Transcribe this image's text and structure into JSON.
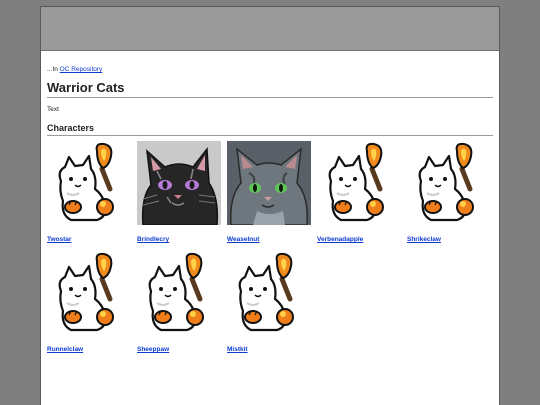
{
  "breadcrumb": {
    "prefix": "...In",
    "link": "OC Repository"
  },
  "page": {
    "title": "Warrior Cats",
    "intro": "Text"
  },
  "section": {
    "title": "Characters"
  },
  "characters": [
    {
      "name": "Twostar",
      "image": "placeholder"
    },
    {
      "name": "Brindlecry",
      "image": "black-cat"
    },
    {
      "name": "Weaselnut",
      "image": "gray-cat"
    },
    {
      "name": "Verbenadapple",
      "image": "placeholder"
    },
    {
      "name": "Shrikeclaw",
      "image": "placeholder"
    },
    {
      "name": "Runnelclaw",
      "image": "placeholder"
    },
    {
      "name": "Sheeppaw",
      "image": "placeholder"
    },
    {
      "name": "Mistkit",
      "image": "placeholder"
    }
  ]
}
